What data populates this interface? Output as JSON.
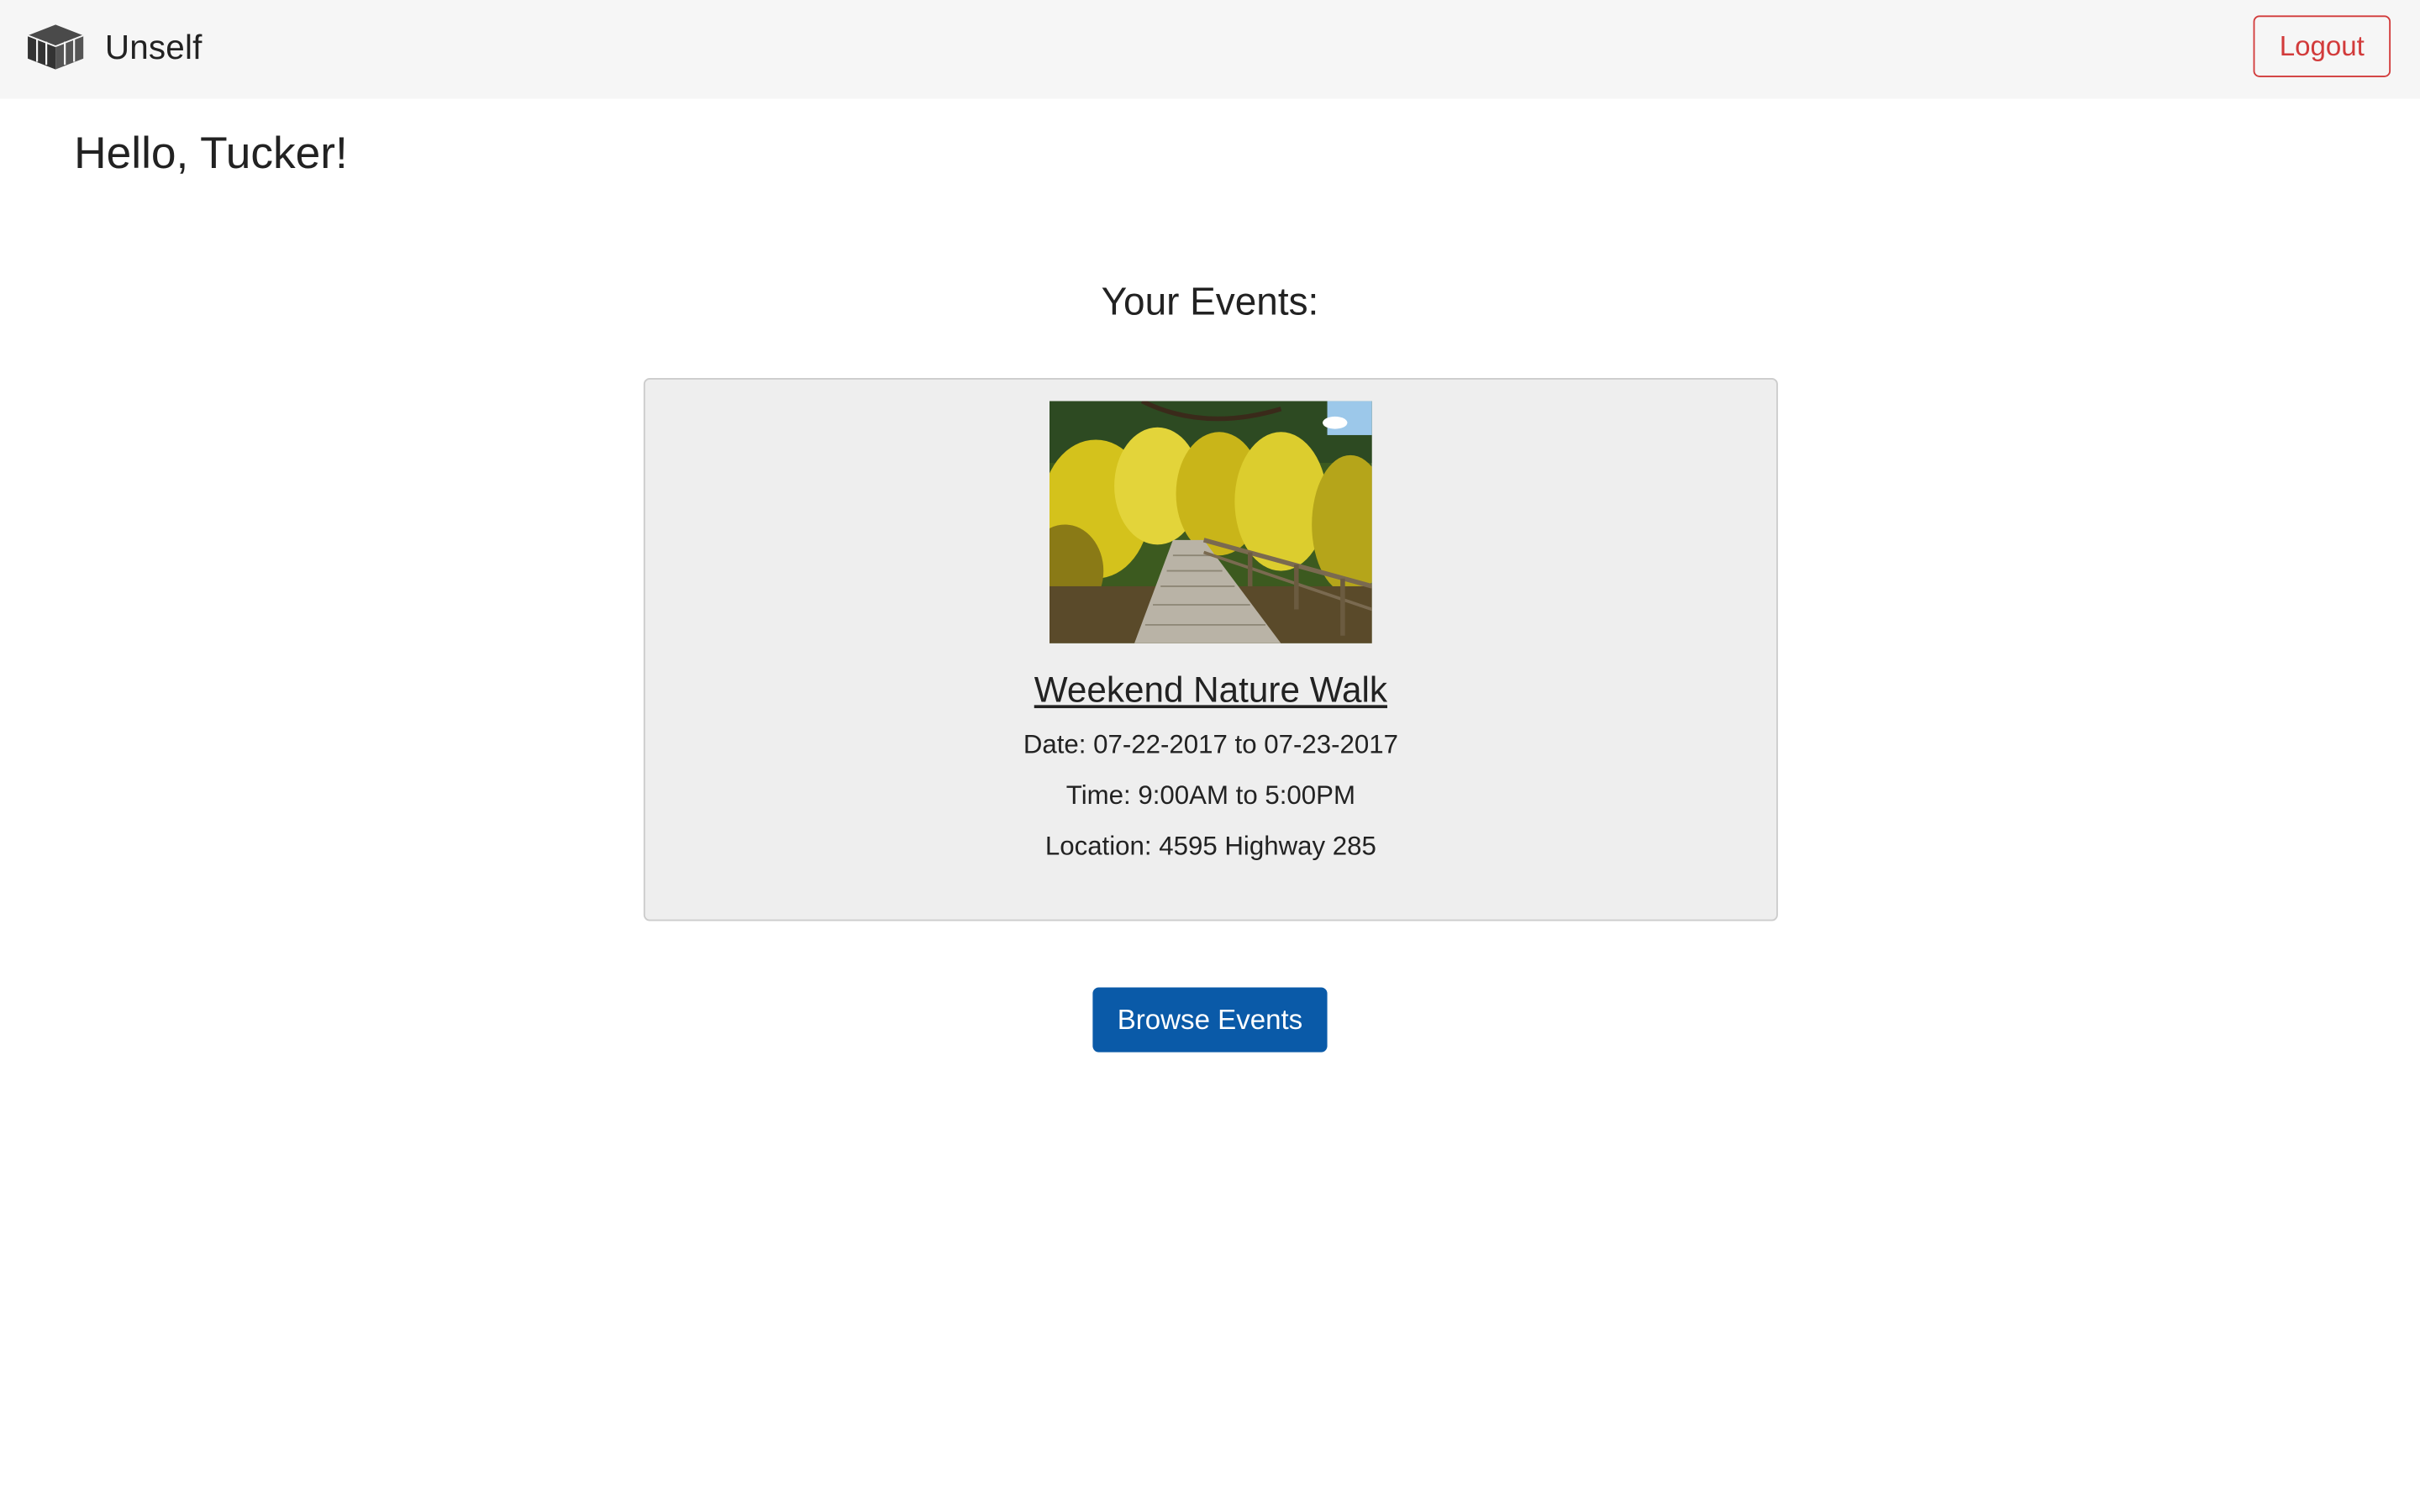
{
  "navbar": {
    "brand_name": "Unself",
    "logout_label": "Logout"
  },
  "greeting": "Hello, Tucker!",
  "events_section": {
    "title": "Your Events:",
    "events": [
      {
        "title": "Weekend Nature Walk",
        "date": "Date: 07-22-2017 to 07-23-2017",
        "time": "Time: 9:00AM to 5:00PM",
        "location": "Location: 4595 Highway 285"
      }
    ]
  },
  "browse_label": "Browse Events",
  "icons": {
    "brand": "cube-logo-icon"
  },
  "colors": {
    "navbar_bg": "#f6f6f6",
    "logout": "#d23b3b",
    "primary": "#0a5aa8",
    "card_bg": "#eeeeee"
  }
}
